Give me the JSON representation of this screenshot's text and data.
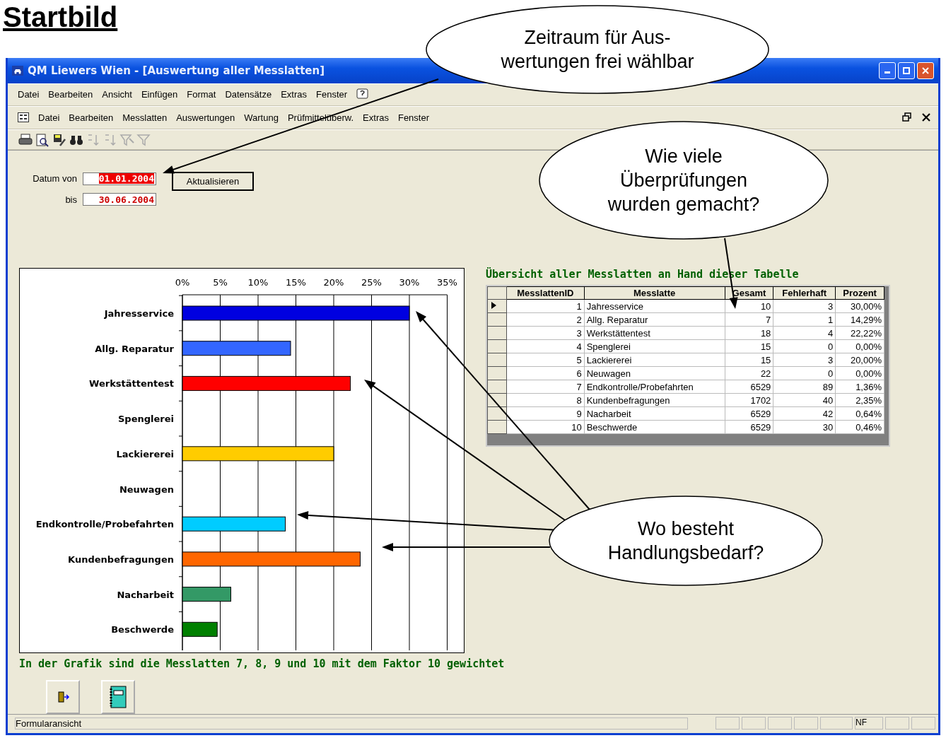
{
  "headline": "Startbild",
  "window": {
    "title": "QM Liewers Wien - [Auswertung aller Messlatten]"
  },
  "menu_bar": [
    "Datei",
    "Bearbeiten",
    "Ansicht",
    "Einfügen",
    "Format",
    "Datensätze",
    "Extras",
    "Fenster"
  ],
  "form_menu_bar": [
    "Datei",
    "Bearbeiten",
    "Messlatten",
    "Auswertungen",
    "Wartung",
    "Prüfmittelüberw.",
    "Extras",
    "Fenster"
  ],
  "date_range": {
    "from_label": "Datum von",
    "from_value": "01.01.2004",
    "from_highlighted": true,
    "to_label": "bis",
    "to_value": "30.06.2004",
    "to_highlighted": false,
    "refresh_button": "Aktualisieren"
  },
  "chart": {
    "chart_data": {
      "type": "bar",
      "orientation": "horizontal",
      "categories": [
        "Jahresservice",
        "Allg. Reparatur",
        "Werkstättentest",
        "Spenglerei",
        "Lackiererei",
        "Neuwagen",
        "Endkontrolle/Probefahrten",
        "Kundenbefragungen",
        "Nacharbeit",
        "Beschwerde"
      ],
      "values": [
        30.0,
        14.3,
        22.2,
        0,
        20.0,
        0,
        13.6,
        23.5,
        6.4,
        4.6
      ],
      "colors": [
        "#0000e0",
        "#3366ff",
        "#ff0000",
        null,
        "#ffcc00",
        null,
        "#00ccff",
        "#ff6600",
        "#339966",
        "#008000"
      ],
      "grid": true,
      "xlim": [
        0,
        35
      ],
      "xticks": [
        {
          "value": 0,
          "label": "0%"
        },
        {
          "value": 5,
          "label": "5%"
        },
        {
          "value": 10,
          "label": "10%"
        },
        {
          "value": 15,
          "label": "15%"
        },
        {
          "value": 20,
          "label": "20%"
        },
        {
          "value": 25,
          "label": "25%"
        },
        {
          "value": 30,
          "label": "30%"
        },
        {
          "value": 35,
          "label": "35%"
        }
      ]
    }
  },
  "chart_note": "In der Grafik sind die Messlatten 7, 8, 9 und 10 mit dem Faktor 10 gewichtet",
  "table": {
    "caption": "Übersicht aller Messlatten an Hand dieser Tabelle",
    "columns": [
      "MesslattenID",
      "Messlatte",
      "Gesamt",
      "Fehlerhaft",
      "Prozent"
    ],
    "rows": [
      {
        "current": true,
        "cells": [
          "1",
          "Jahresservice",
          "10",
          "3",
          "30,00%"
        ]
      },
      {
        "current": false,
        "cells": [
          "2",
          "Allg. Reparatur",
          "7",
          "1",
          "14,29%"
        ]
      },
      {
        "current": false,
        "cells": [
          "3",
          "Werkstättentest",
          "18",
          "4",
          "22,22%"
        ]
      },
      {
        "current": false,
        "cells": [
          "4",
          "Spenglerei",
          "15",
          "0",
          "0,00%"
        ]
      },
      {
        "current": false,
        "cells": [
          "5",
          "Lackiererei",
          "15",
          "3",
          "20,00%"
        ]
      },
      {
        "current": false,
        "cells": [
          "6",
          "Neuwagen",
          "22",
          "0",
          "0,00%"
        ]
      },
      {
        "current": false,
        "cells": [
          "7",
          "Endkontrolle/Probefahrten",
          "6529",
          "89",
          "1,36%"
        ]
      },
      {
        "current": false,
        "cells": [
          "8",
          "Kundenbefragungen",
          "1702",
          "40",
          "2,35%"
        ]
      },
      {
        "current": false,
        "cells": [
          "9",
          "Nacharbeit",
          "6529",
          "42",
          "0,64%"
        ]
      },
      {
        "current": false,
        "cells": [
          "10",
          "Beschwerde",
          "6529",
          "30",
          "0,46%"
        ]
      }
    ]
  },
  "status_bar": {
    "text": "Formularansicht",
    "indicator": "NF"
  },
  "callouts": [
    {
      "text": "Zeitraum für Aus-\nwertungen frei wählbar"
    },
    {
      "text": "Wie viele\nÜberprüfungen\nwurden gemacht?"
    },
    {
      "text": "Wo besteht\nHandlungsbedarf?"
    }
  ]
}
